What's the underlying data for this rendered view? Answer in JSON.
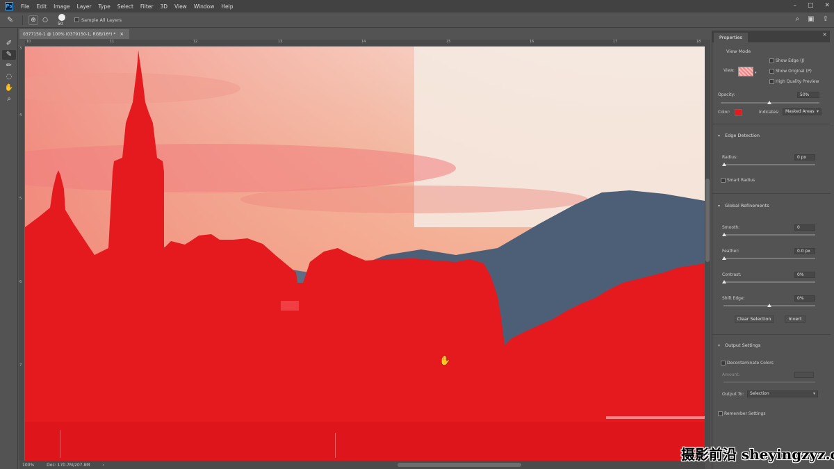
{
  "app": {
    "logo": "Ps",
    "menu": [
      "File",
      "Edit",
      "Image",
      "Layer",
      "Type",
      "Select",
      "Filter",
      "3D",
      "View",
      "Window",
      "Help"
    ]
  },
  "options": {
    "brush_size": "50",
    "sample_all_layers": "Sample All Layers"
  },
  "document": {
    "tab_title": "0377150-1 @ 100% (0379150-1, RGB/16*) *",
    "tab_close": "×"
  },
  "rulers": {
    "top": [
      "10",
      "11",
      "12",
      "13",
      "14",
      "15",
      "16",
      "17",
      "18"
    ],
    "left": [
      "3",
      "4",
      "5",
      "6",
      "7"
    ]
  },
  "status": {
    "zoom": "100%",
    "doc": "Doc: 170.7M/207.8M",
    "arrow": "›"
  },
  "panel": {
    "tab": "Properties",
    "view_mode_title": "View Mode",
    "view_label": "View:",
    "show_edge": "Show Edge (J)",
    "show_original": "Show Original (P)",
    "high_quality_preview": "High Quality Preview",
    "opacity_label": "Opacity:",
    "opacity_value": "50%",
    "color_label": "Color:",
    "indicates_label": "Indicates:",
    "indicates_value": "Masked Areas",
    "edge_detection": "Edge Detection",
    "radius_label": "Radius:",
    "radius_value": "0 px",
    "smart_radius": "Smart Radius",
    "global_refinements": "Global Refinements",
    "smooth_label": "Smooth:",
    "smooth_value": "0",
    "feather_label": "Feather:",
    "feather_value": "0.0 px",
    "contrast_label": "Contrast:",
    "contrast_value": "0%",
    "shift_edge_label": "Shift Edge:",
    "shift_edge_value": "0%",
    "clear_selection": "Clear Selection",
    "invert": "Invert",
    "output_settings": "Output Settings",
    "decontaminate": "Decontaminate Colors",
    "amount_label": "Amount:",
    "output_to_label": "Output To:",
    "output_to_value": "Selection",
    "remember_settings": "Remember Settings"
  },
  "colors": {
    "overlay": "#e51a1e",
    "sky": "#f3e9e0",
    "mountain": "#4d5f77"
  },
  "watermark": "摄影前沿 sheyingzyz.com"
}
